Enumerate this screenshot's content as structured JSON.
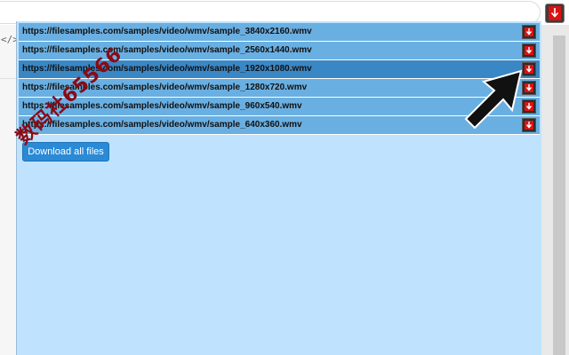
{
  "files": [
    {
      "url": "https://filesamples.com/samples/video/wmv/sample_3840x2160.wmv",
      "selected": false
    },
    {
      "url": "https://filesamples.com/samples/video/wmv/sample_2560x1440.wmv",
      "selected": false
    },
    {
      "url": "https://filesamples.com/samples/video/wmv/sample_1920x1080.wmv",
      "selected": true
    },
    {
      "url": "https://filesamples.com/samples/video/wmv/sample_1280x720.wmv",
      "selected": false
    },
    {
      "url": "https://filesamples.com/samples/video/wmv/sample_960x540.wmv",
      "selected": false
    },
    {
      "url": "https://filesamples.com/samples/video/wmv/sample_640x360.wmv",
      "selected": false
    }
  ],
  "download_all_label": "Download all files",
  "watermark": "数码社65566",
  "toolbar": {
    "extension_icon": "download-arrow-icon",
    "code_icon": "</>"
  },
  "colors": {
    "popup_bg": "#bfe3ff",
    "row_bg": "#6aafe2",
    "row_selected_bg": "#3a87c6",
    "button_bg": "#2b8ad6",
    "download_arrow": "#dd1111"
  }
}
